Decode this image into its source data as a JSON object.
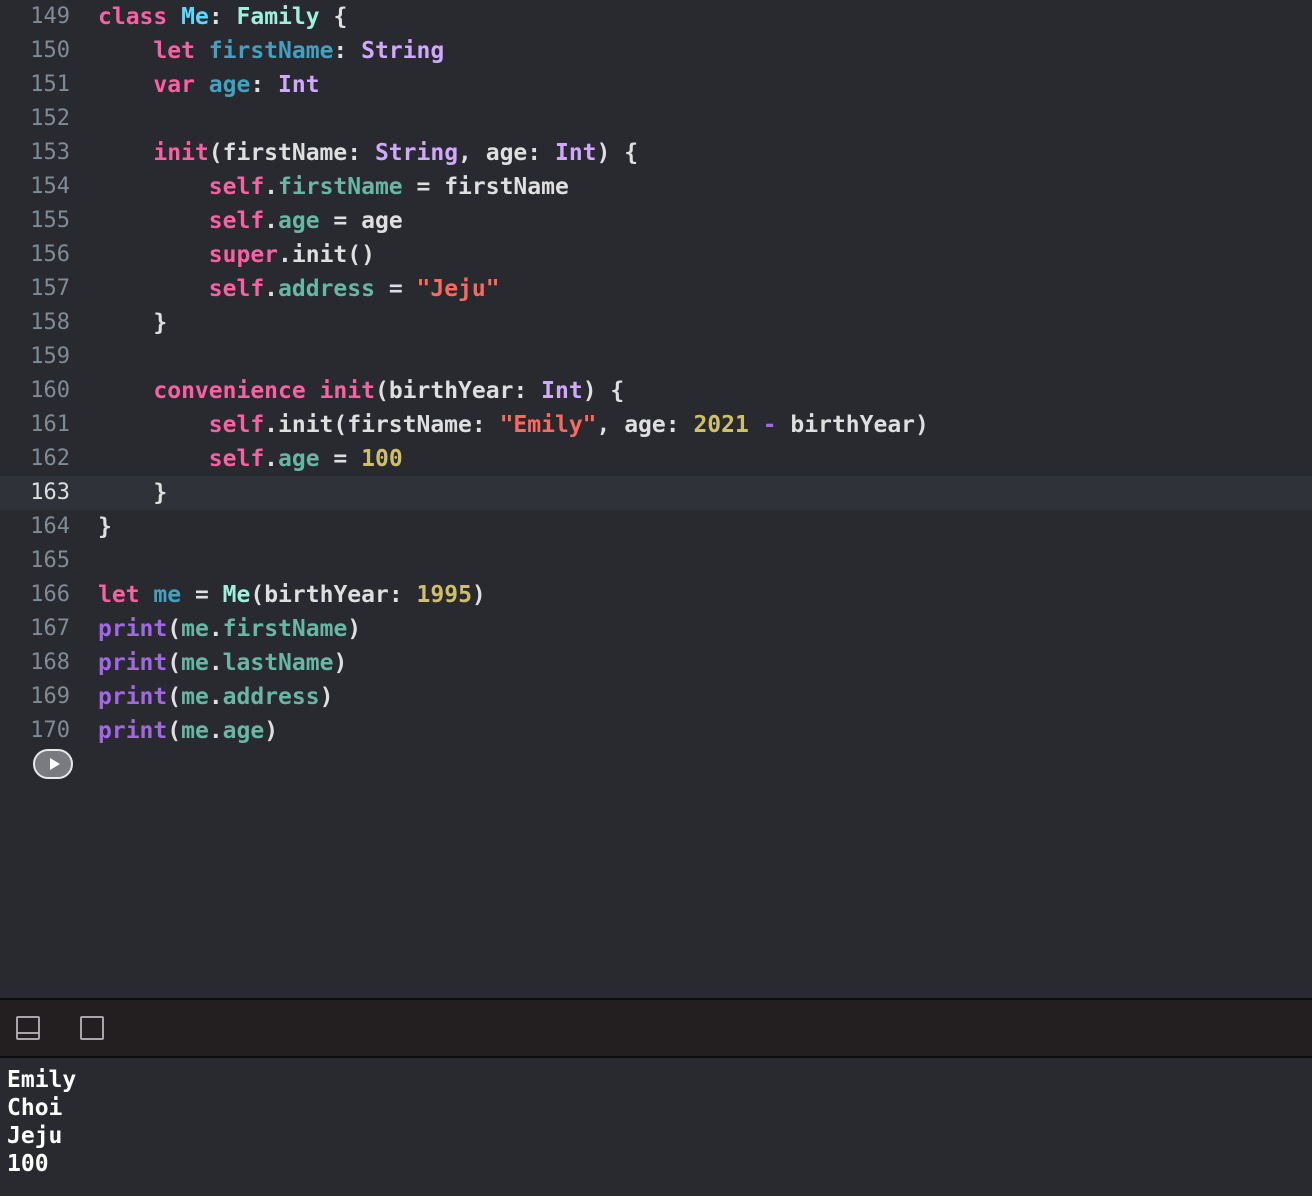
{
  "editor": {
    "current_line": "163",
    "lines": [
      {
        "n": "149",
        "tokens": [
          [
            "kw",
            "class"
          ],
          [
            "plain",
            " "
          ],
          [
            "decl",
            "Me"
          ],
          [
            "plain",
            ": "
          ],
          [
            "fam",
            "Family"
          ],
          [
            "plain",
            " {"
          ]
        ]
      },
      {
        "n": "150",
        "tokens": [
          [
            "plain",
            "    "
          ],
          [
            "kw",
            "let"
          ],
          [
            "plain",
            " "
          ],
          [
            "decl-prop",
            "firstName"
          ],
          [
            "plain",
            ": "
          ],
          [
            "ty",
            "String"
          ]
        ]
      },
      {
        "n": "151",
        "tokens": [
          [
            "plain",
            "    "
          ],
          [
            "kw",
            "var"
          ],
          [
            "plain",
            " "
          ],
          [
            "decl-prop",
            "age"
          ],
          [
            "plain",
            ": "
          ],
          [
            "ty",
            "Int"
          ]
        ]
      },
      {
        "n": "152",
        "tokens": []
      },
      {
        "n": "153",
        "tokens": [
          [
            "plain",
            "    "
          ],
          [
            "kw",
            "init"
          ],
          [
            "plain",
            "(firstName: "
          ],
          [
            "ty",
            "String"
          ],
          [
            "plain",
            ", age: "
          ],
          [
            "ty",
            "Int"
          ],
          [
            "plain",
            ") {"
          ]
        ]
      },
      {
        "n": "154",
        "tokens": [
          [
            "plain",
            "        "
          ],
          [
            "kw",
            "self"
          ],
          [
            "plain",
            "."
          ],
          [
            "prop",
            "firstName"
          ],
          [
            "plain",
            " = firstName"
          ]
        ]
      },
      {
        "n": "155",
        "tokens": [
          [
            "plain",
            "        "
          ],
          [
            "kw",
            "self"
          ],
          [
            "plain",
            "."
          ],
          [
            "prop",
            "age"
          ],
          [
            "plain",
            " = age"
          ]
        ]
      },
      {
        "n": "156",
        "tokens": [
          [
            "plain",
            "        "
          ],
          [
            "kw",
            "super"
          ],
          [
            "plain",
            ".init()"
          ]
        ]
      },
      {
        "n": "157",
        "tokens": [
          [
            "plain",
            "        "
          ],
          [
            "kw",
            "self"
          ],
          [
            "plain",
            "."
          ],
          [
            "prop",
            "address"
          ],
          [
            "plain",
            " = "
          ],
          [
            "str",
            "\"Jeju\""
          ]
        ]
      },
      {
        "n": "158",
        "tokens": [
          [
            "plain",
            "    }"
          ]
        ]
      },
      {
        "n": "159",
        "tokens": []
      },
      {
        "n": "160",
        "tokens": [
          [
            "plain",
            "    "
          ],
          [
            "kw",
            "convenience"
          ],
          [
            "plain",
            " "
          ],
          [
            "kw",
            "init"
          ],
          [
            "plain",
            "(birthYear: "
          ],
          [
            "ty",
            "Int"
          ],
          [
            "plain",
            ") {"
          ]
        ]
      },
      {
        "n": "161",
        "tokens": [
          [
            "plain",
            "        "
          ],
          [
            "kw",
            "self"
          ],
          [
            "plain",
            ".init(firstName: "
          ],
          [
            "str",
            "\"Emily\""
          ],
          [
            "plain",
            ", age: "
          ],
          [
            "num",
            "2021"
          ],
          [
            "plain",
            " "
          ],
          [
            "fn",
            "-"
          ],
          [
            "plain",
            " birthYear)"
          ]
        ]
      },
      {
        "n": "162",
        "tokens": [
          [
            "plain",
            "        "
          ],
          [
            "kw",
            "self"
          ],
          [
            "plain",
            "."
          ],
          [
            "prop",
            "age"
          ],
          [
            "plain",
            " = "
          ],
          [
            "num",
            "100"
          ]
        ]
      },
      {
        "n": "163",
        "tokens": [
          [
            "plain",
            "    }"
          ]
        ]
      },
      {
        "n": "164",
        "tokens": [
          [
            "plain",
            "}"
          ]
        ]
      },
      {
        "n": "165",
        "tokens": []
      },
      {
        "n": "166",
        "tokens": [
          [
            "kw",
            "let"
          ],
          [
            "plain",
            " "
          ],
          [
            "decl-prop",
            "me"
          ],
          [
            "plain",
            " = "
          ],
          [
            "mecls",
            "Me"
          ],
          [
            "plain",
            "(birthYear: "
          ],
          [
            "num",
            "1995"
          ],
          [
            "plain",
            ")"
          ]
        ]
      },
      {
        "n": "167",
        "tokens": [
          [
            "fn",
            "print"
          ],
          [
            "plain",
            "("
          ],
          [
            "prop",
            "me"
          ],
          [
            "plain",
            "."
          ],
          [
            "prop",
            "firstName"
          ],
          [
            "plain",
            ")"
          ]
        ]
      },
      {
        "n": "168",
        "tokens": [
          [
            "fn",
            "print"
          ],
          [
            "plain",
            "("
          ],
          [
            "prop",
            "me"
          ],
          [
            "plain",
            "."
          ],
          [
            "prop",
            "lastName"
          ],
          [
            "plain",
            ")"
          ]
        ]
      },
      {
        "n": "169",
        "tokens": [
          [
            "fn",
            "print"
          ],
          [
            "plain",
            "("
          ],
          [
            "prop",
            "me"
          ],
          [
            "plain",
            "."
          ],
          [
            "prop",
            "address"
          ],
          [
            "plain",
            ")"
          ]
        ]
      },
      {
        "n": "170",
        "tokens": [
          [
            "fn",
            "print"
          ],
          [
            "plain",
            "("
          ],
          [
            "prop",
            "me"
          ],
          [
            "plain",
            "."
          ],
          [
            "prop",
            "age"
          ],
          [
            "plain",
            ")"
          ]
        ]
      }
    ]
  },
  "run_button": {
    "icon": "play-icon"
  },
  "toolbar": {
    "icons": [
      "bottom-panel-toggle-icon",
      "panel-toggle-icon"
    ]
  },
  "console": {
    "output": [
      "Emily",
      "Choi",
      "Jeju",
      "100"
    ]
  },
  "colors": {
    "background": "#292a30",
    "keyword": "#fc5fa3",
    "type": "#d0a8ff",
    "string": "#fc6a5d",
    "number": "#d0bf69",
    "property": "#67b7a4",
    "function": "#a167e6"
  }
}
